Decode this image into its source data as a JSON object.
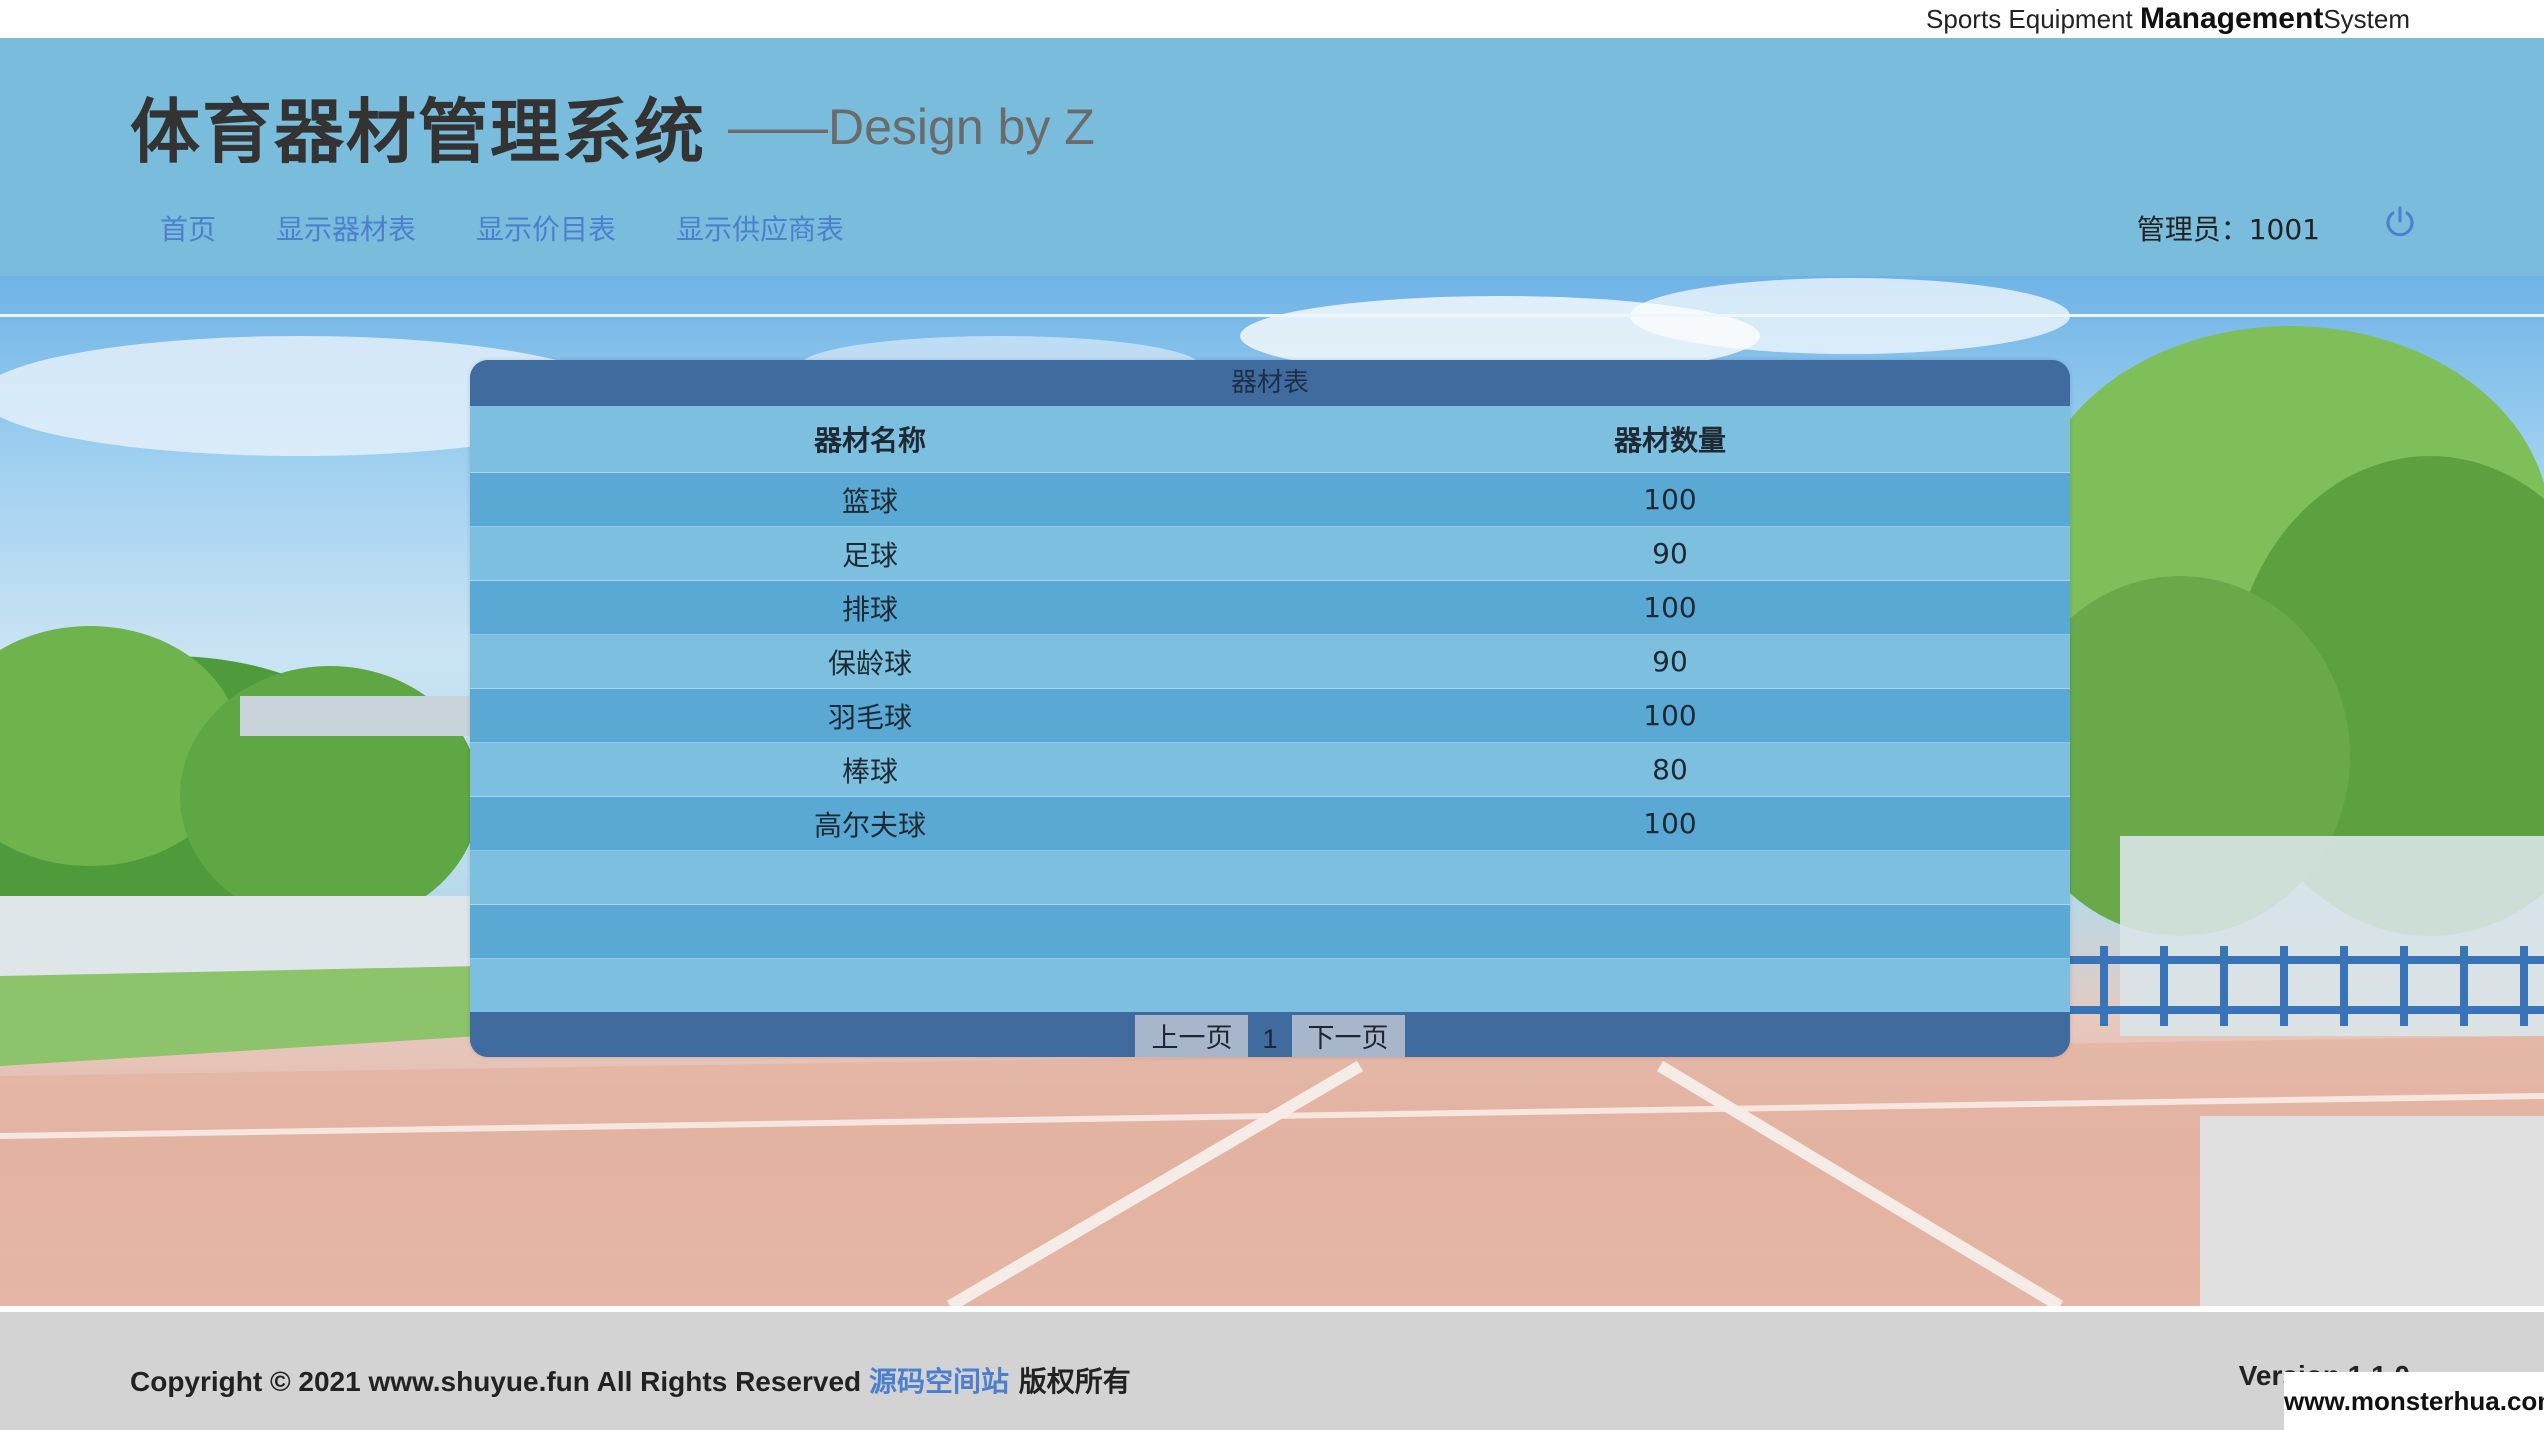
{
  "top_bar": {
    "brand_pre": "Sports Equipment ",
    "brand_bold": "Management",
    "brand_post": "System"
  },
  "header": {
    "title": "体育器材管理系统",
    "subtitle": "——Design by Z",
    "nav": [
      {
        "label": "首页"
      },
      {
        "label": "显示器材表"
      },
      {
        "label": "显示价目表"
      },
      {
        "label": "显示供应商表"
      }
    ],
    "admin_label": "管理员：1001",
    "power_icon": "power-icon"
  },
  "table": {
    "caption": "器材表",
    "columns": [
      "器材名称",
      "器材数量"
    ],
    "rows": [
      [
        "篮球",
        "100"
      ],
      [
        "足球",
        "90"
      ],
      [
        "排球",
        "100"
      ],
      [
        "保龄球",
        "90"
      ],
      [
        "羽毛球",
        "100"
      ],
      [
        "棒球",
        "80"
      ],
      [
        "高尔夫球",
        "100"
      ],
      [
        "",
        ""
      ],
      [
        "",
        ""
      ],
      [
        "",
        ""
      ]
    ],
    "pager": {
      "prev_label": "上一页",
      "page": "1",
      "next_label": "下一页"
    }
  },
  "footer": {
    "copyright_text": "Copyright © 2021 www.shuyue.fun All Rights Reserved ",
    "copyright_link": "源码空间站",
    "copyright_suffix": " 版权所有",
    "version": "Version 1.1.0"
  },
  "watermark": "www.monsterhua.com",
  "colors": {
    "header_bg": "#79bcdb",
    "panel_dark": "#406b9f",
    "row_dark": "#5aa9d4",
    "row_light": "#7cbfdf",
    "link": "#4d7fcf",
    "footer_bg": "#d3d3d3"
  }
}
